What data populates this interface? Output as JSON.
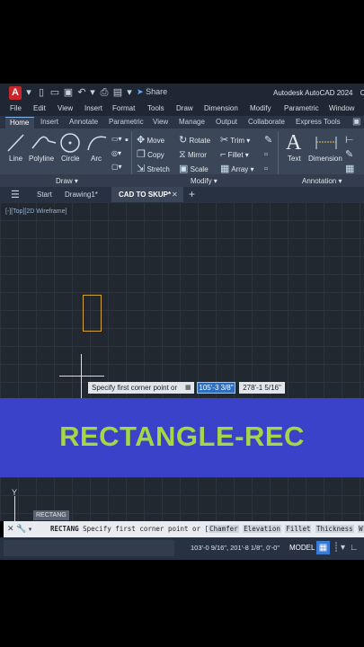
{
  "quick_access": {
    "share_label": "Share"
  },
  "app": {
    "title": "Autodesk AutoCAD 2024",
    "title_suffix": "CA"
  },
  "menu": [
    "File",
    "Edit",
    "View",
    "Insert",
    "Format",
    "Tools",
    "Draw",
    "Dimension",
    "Modify",
    "Parametric",
    "Window"
  ],
  "ribbon_tabs": [
    "Home",
    "Insert",
    "Annotate",
    "Parametric",
    "View",
    "Manage",
    "Output",
    "Collaborate",
    "Express Tools"
  ],
  "draw_panel": {
    "tools": [
      "Line",
      "Polyline",
      "Circle",
      "Arc"
    ],
    "title": "Draw"
  },
  "modify_panel": {
    "col1": [
      "Move",
      "Copy",
      "Stretch"
    ],
    "col2": [
      "Rotate",
      "Mirror",
      "Scale"
    ],
    "col3": [
      "Trim",
      "Fillet",
      "Array"
    ],
    "title": "Modify"
  },
  "annotation_panel": {
    "text_label": "Text",
    "dimension_label": "Dimension",
    "title": "Annotation"
  },
  "file_tabs": {
    "start": "Start",
    "drawing1": "Drawing1*",
    "active": "CAD TO SKUP*"
  },
  "viewport": {
    "label": "[-][Top][2D Wireframe]"
  },
  "dynamic_input": {
    "prompt": "Specify first corner point or",
    "x_value": "105'-3 3/8\"",
    "y_value": "278'-1 5/16\""
  },
  "banner": {
    "text": "RECTANGLE-REC"
  },
  "ucs": {
    "y_label": "Y"
  },
  "command": {
    "history": "RECTANG",
    "name": "RECTANG",
    "prompt": "Specify first corner point or [",
    "options": [
      "Chamfer",
      "Elevation",
      "Fillet",
      "Thickness",
      "W"
    ]
  },
  "status": {
    "coordinates": "103'-0 9/16\", 201'-8 1/8\", 0'-0\"",
    "model": "MODEL"
  },
  "colors": {
    "banner_bg": "#3942c9",
    "banner_text": "#a4d645",
    "rect_stroke": "#d2a13a",
    "coord_highlight": "#2f6fbf"
  }
}
